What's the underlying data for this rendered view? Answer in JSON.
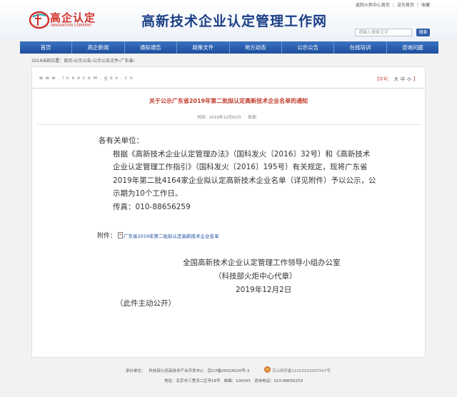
{
  "header": {
    "logo_text": "高企认定",
    "logo_subtext": "INNOVATION COMPANY",
    "site_title": "高新技术企业认定管理工作网",
    "links": [
      "返回火炬中心首页",
      "设为首页",
      "收藏"
    ],
    "search_placeholder": "请输入搜索文字",
    "search_button": "搜索"
  },
  "nav": {
    "items": [
      "首页",
      "高企新闻",
      "通知通告",
      "政策文件",
      "地方动态",
      "公示公告",
      "在线培训",
      "咨询问题"
    ]
  },
  "breadcrumb": "2019当前位置：首页›公示公告›公示公告文件›广东省›",
  "article": {
    "site_domain": "w w w . i n n o c o m . g o v . c n",
    "font_size_label": "【字号：",
    "font_sizes": [
      "大",
      "中",
      "小"
    ],
    "font_size_close": "】",
    "title": "关于公示广东省2019年第二批拟认定高新技术企业名单的通知",
    "time_label": "时间：2019年12月02日",
    "source_label": "来源：",
    "greeting": "各有关单位：",
    "paragraph": "根据《高新技术企业认定管理办法》（国科发火〔2016〕32号）和《高新技术企业认定管理工作指引》（国科发火〔2016〕195号）有关规定，现将广东省2019年第二批4164家企业拟认定高新技术企业名单（详见附件）予以公示，公示期为10个工作日。",
    "fax": "传真：010-88656259",
    "attachment_label": "附件：",
    "attachment_link": "广东省2019年第二批拟认定高新技术企业名单",
    "signature_org": "全国高新技术企业认定管理工作领导小组办公室",
    "signature_sub": "（科技部火炬中心代章）",
    "signature_date": "2019年12月2日",
    "public_note": "（此件主动公开）"
  },
  "footer": {
    "host_label": "承办单位：",
    "host": "科技部火炬高技术产业开发中心",
    "icp": "京ICP备05024026号-3",
    "police": "京公网安备11010202007547号",
    "address": "地址：北京市三里河二区甲18号",
    "postcode": "邮编：100045",
    "phone": "咨询电话：010-88656259"
  },
  "colors": {
    "nav_blue": "#1d4f9c",
    "title_red": "#c0392b",
    "brand_red": "#d0302a"
  }
}
